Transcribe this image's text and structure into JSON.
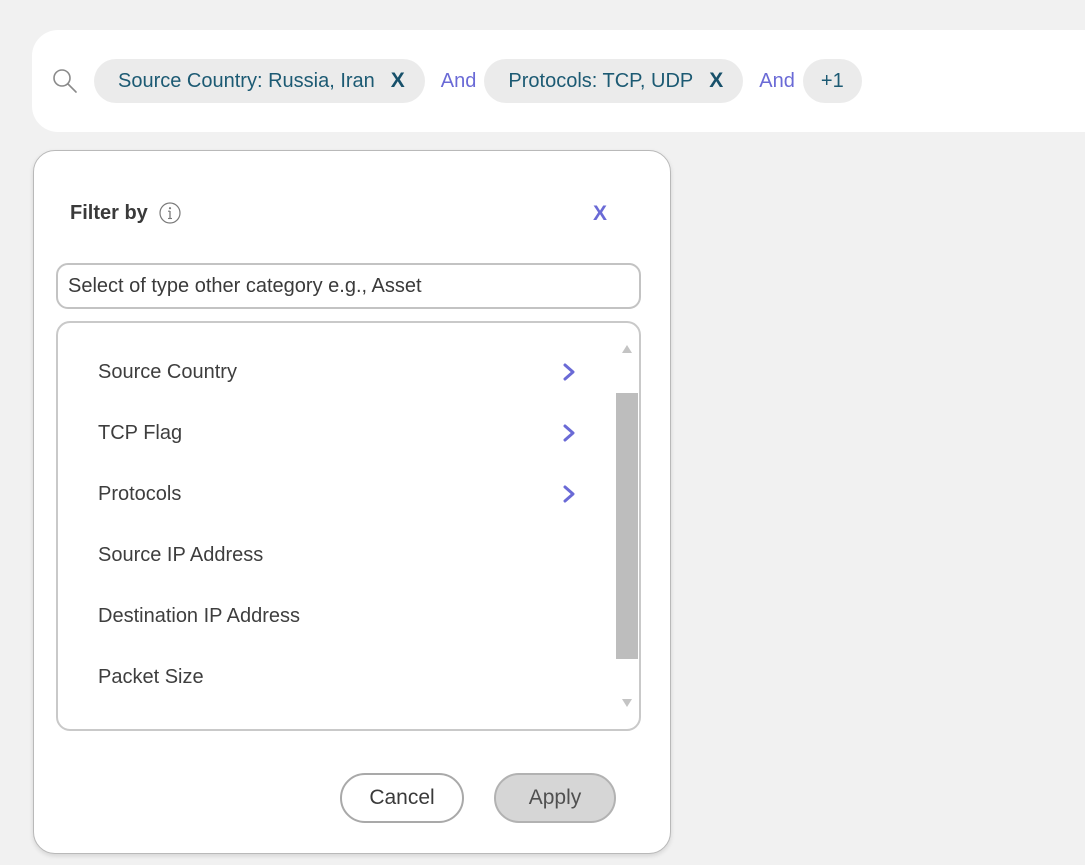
{
  "filter_bar": {
    "chips": [
      {
        "label": "Source Country: Russia, Iran",
        "remove": "X"
      },
      {
        "label": "Protocols: TCP, UDP",
        "remove": "X"
      }
    ],
    "conjunctions": [
      "And",
      "And"
    ],
    "more_chip": "+1"
  },
  "panel": {
    "title": "Filter by",
    "close": "X",
    "search_placeholder": "Select of type other category e.g., Asset",
    "items": [
      {
        "label": "Source Country",
        "has_submenu": true
      },
      {
        "label": "TCP Flag",
        "has_submenu": true
      },
      {
        "label": "Protocols",
        "has_submenu": true
      },
      {
        "label": "Source IP Address",
        "has_submenu": false
      },
      {
        "label": "Destination IP Address",
        "has_submenu": false
      },
      {
        "label": "Packet Size",
        "has_submenu": false
      }
    ],
    "cancel_label": "Cancel",
    "apply_label": "Apply"
  },
  "colors": {
    "chip_text": "#1c5a73",
    "accent": "#6a6ad6",
    "background": "#f1f1f1"
  },
  "icons": [
    "search-icon",
    "info-icon",
    "chevron-right-icon",
    "scroll-up-icon",
    "scroll-down-icon"
  ]
}
